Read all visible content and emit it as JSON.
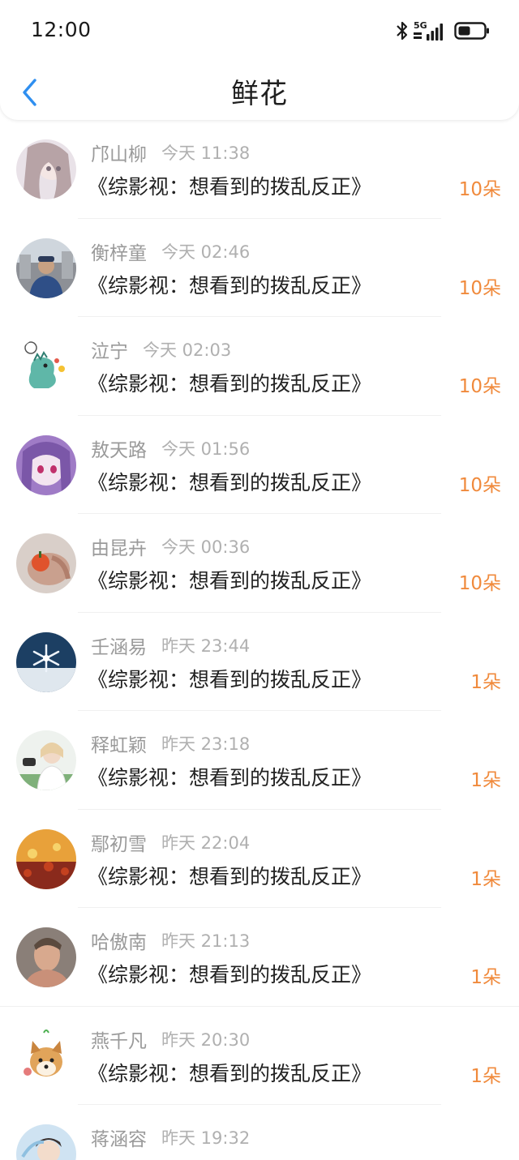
{
  "status_bar": {
    "time": "12:00",
    "network_label": "5G",
    "icons": [
      "bluetooth-icon",
      "signal-icon",
      "battery-icon"
    ]
  },
  "header": {
    "title": "鲜花",
    "back_icon": "chevron-left-icon"
  },
  "colors": {
    "accent_blue": "#2f8ff0",
    "count_orange": "#f08a3c",
    "name_gray": "#9a9a9a",
    "time_gray": "#b0b0b0",
    "title_text": "#222222"
  },
  "items": [
    {
      "name": "邝山柳",
      "time": "今天 11:38",
      "title": "《综影视：想看到的拨乱反正》",
      "count": "10朵"
    },
    {
      "name": "衡梓童",
      "time": "今天 02:46",
      "title": "《综影视：想看到的拨乱反正》",
      "count": "10朵"
    },
    {
      "name": "泣宁",
      "time": "今天 02:03",
      "title": "《综影视：想看到的拨乱反正》",
      "count": "10朵"
    },
    {
      "name": "敖天路",
      "time": "今天 01:56",
      "title": "《综影视：想看到的拨乱反正》",
      "count": "10朵"
    },
    {
      "name": "由昆卉",
      "time": "今天 00:36",
      "title": "《综影视：想看到的拨乱反正》",
      "count": "10朵"
    },
    {
      "name": "壬涵易",
      "time": "昨天 23:44",
      "title": "《综影视：想看到的拨乱反正》",
      "count": "1朵"
    },
    {
      "name": "释虹颖",
      "time": "昨天 23:18",
      "title": "《综影视：想看到的拨乱反正》",
      "count": "1朵"
    },
    {
      "name": "鄢初雪",
      "time": "昨天 22:04",
      "title": "《综影视：想看到的拨乱反正》",
      "count": "1朵"
    },
    {
      "name": "哈傲南",
      "time": "昨天 21:13",
      "title": "《综影视：想看到的拨乱反正》",
      "count": "1朵"
    },
    {
      "name": "燕千凡",
      "time": "昨天 20:30",
      "title": "《综影视：想看到的拨乱反正》",
      "count": "1朵"
    },
    {
      "name": "蒋涵容",
      "time": "昨天 19:32",
      "title": "",
      "count": ""
    }
  ]
}
